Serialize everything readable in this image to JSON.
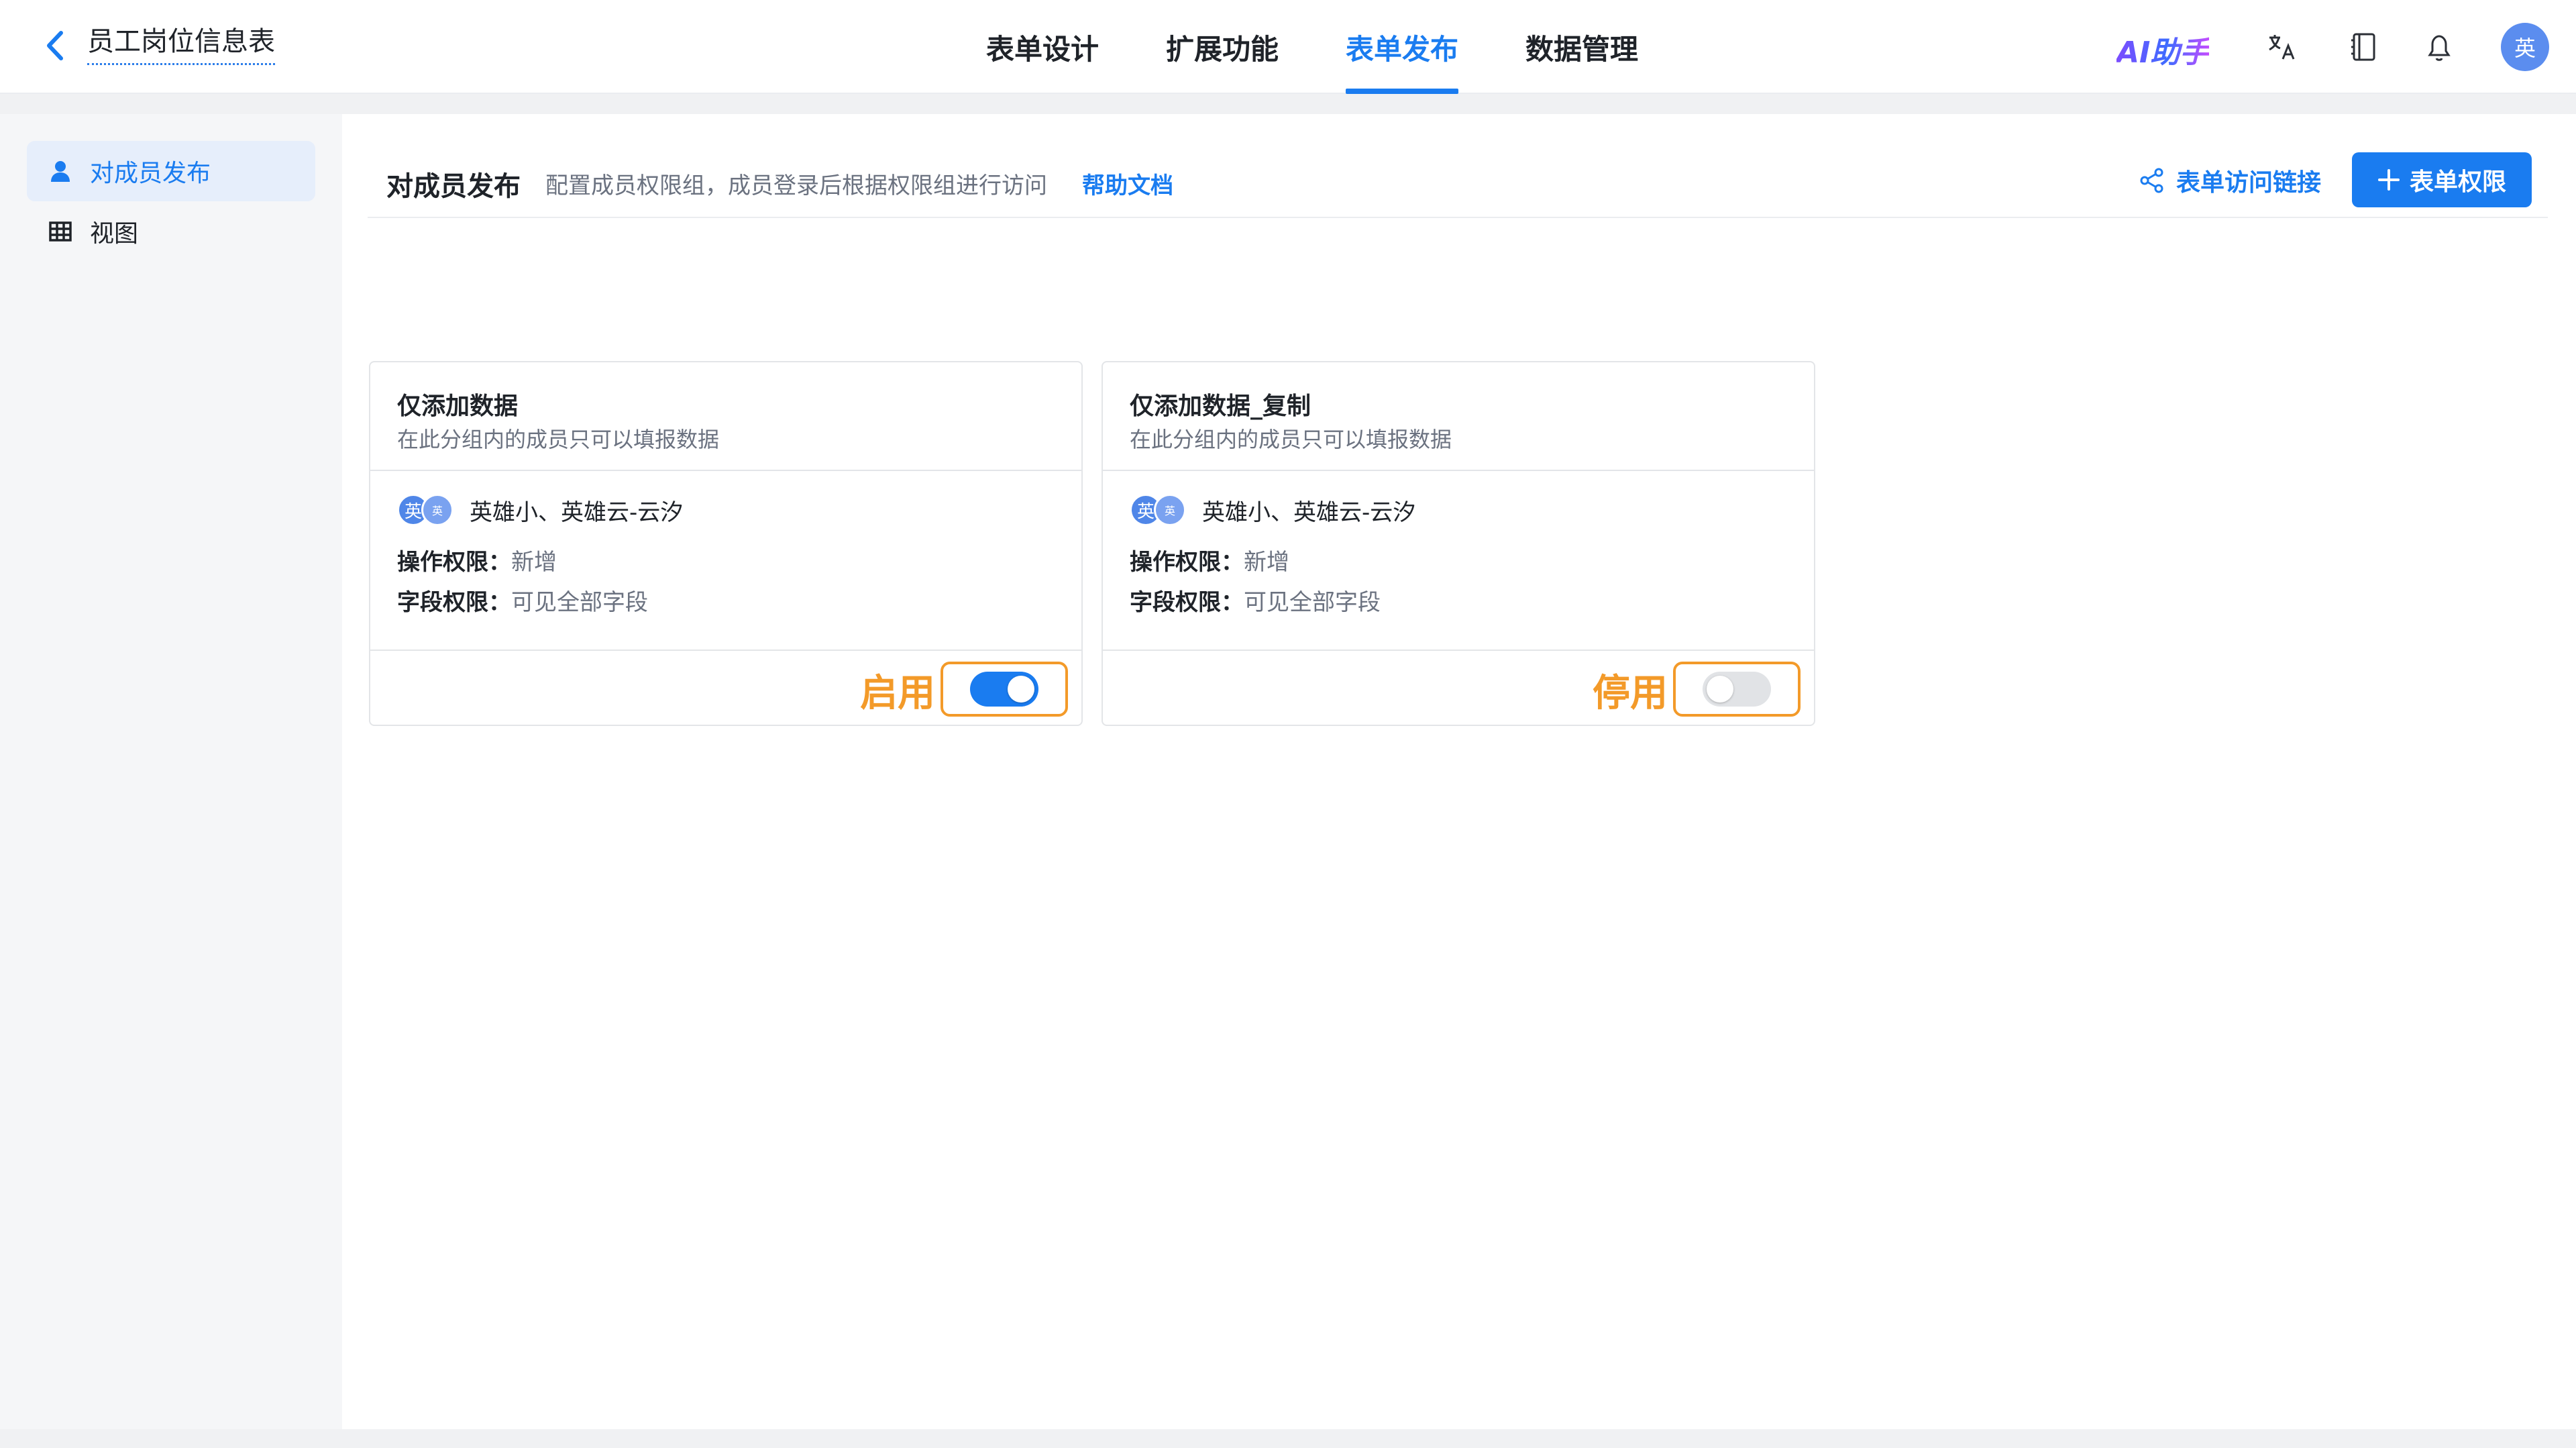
{
  "header": {
    "back_icon": "chevron-left-icon",
    "title": "员工岗位信息表",
    "tabs": [
      {
        "label": "表单设计",
        "active": false
      },
      {
        "label": "扩展功能",
        "active": false
      },
      {
        "label": "表单发布",
        "active": true
      },
      {
        "label": "数据管理",
        "active": false
      }
    ],
    "ai_label": "AI助手",
    "icons": [
      "translate-icon",
      "book-icon",
      "bell-icon"
    ],
    "avatar": "英"
  },
  "sidebar": {
    "items": [
      {
        "label": "对成员发布",
        "icon": "user-icon",
        "active": true
      },
      {
        "label": "视图",
        "icon": "grid-icon",
        "active": false
      }
    ]
  },
  "section": {
    "title": "对成员发布",
    "description": "配置成员权限组，成员登录后根据权限组进行访问",
    "help_link": "帮助文档",
    "access_link": "表单访问链接",
    "add_button": "表单权限"
  },
  "cards": [
    {
      "name": "仅添加数据",
      "subtitle": "在此分组内的成员只可以填报数据",
      "avatar_main": "英",
      "avatar_small": "英",
      "members": "英雄小、英雄云-云汐",
      "op_label": "操作权限：",
      "op_value": "新增",
      "field_label": "字段权限：",
      "field_value": "可见全部字段",
      "status_label": "启用",
      "enabled": true
    },
    {
      "name": "仅添加数据_复制",
      "subtitle": "在此分组内的成员只可以填报数据",
      "avatar_main": "英",
      "avatar_small": "英",
      "members": "英雄小、英雄云-云汐",
      "op_label": "操作权限：",
      "op_value": "新增",
      "field_label": "字段权限：",
      "field_value": "可见全部字段",
      "status_label": "停用",
      "enabled": false
    }
  ],
  "colors": {
    "primary": "#1a7cf0",
    "highlight": "#f39a29"
  }
}
